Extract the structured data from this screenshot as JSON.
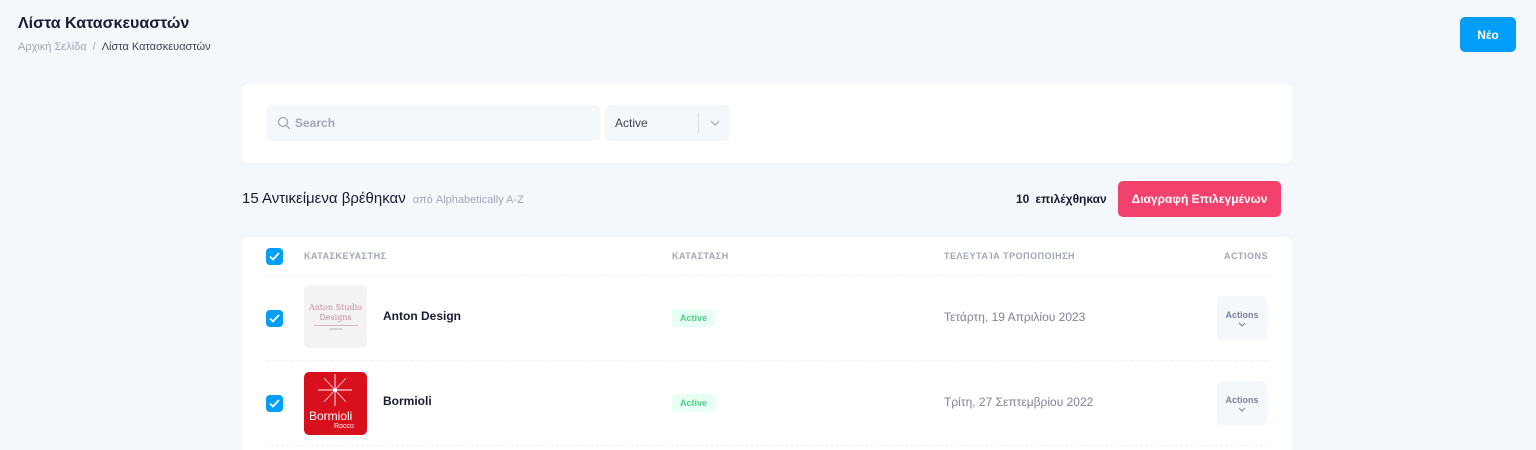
{
  "header": {
    "title": "Λίστα Κατασκευαστών",
    "breadcrumb": {
      "home": "Αρχική Σελίδα",
      "separator": "/",
      "current": "Λίστα Κατασκευαστών"
    },
    "new_button": "Νέο"
  },
  "filters": {
    "search_placeholder": "Search",
    "status_value": "Active"
  },
  "toolbar": {
    "count_text": "15 Αντικείμενα βρέθηκαν",
    "sort_text": "από Alphabetically A-Z",
    "selected_number": "10",
    "selected_label": "επιλέχθηκαν",
    "delete_button": "Διαγραφή Επιλεγμένων"
  },
  "table": {
    "columns": [
      "ΚΑΤΑΣΚΕΥΑΣΤΗΣ",
      "ΚΑΤΑΣΤΑΣΗ",
      "ΤΕΛΕΥΤΑΊΑ ΤΡΟΠΟΠΟΙΗΣΗ",
      "ACTIONS"
    ],
    "rows": [
      {
        "name": "Anton Design",
        "status": "Active",
        "date": "Τετάρτη, 19 Απριλίου 2023",
        "action": "Actions",
        "checked": true,
        "logo": {
          "line1": "Anton Studio",
          "line2": "Designs",
          "line3": "LONDON"
        }
      },
      {
        "name": "Bormioli",
        "status": "Active",
        "date": "Τρίτη, 27 Σεπτεμβρίου 2022",
        "action": "Actions",
        "checked": true,
        "logo": {
          "line1": "Bormioli",
          "line2": "Rocco"
        }
      }
    ]
  },
  "colors": {
    "primary": "#009ef7",
    "danger": "#f1416c",
    "success": "#50cd89",
    "bormioli_red": "#d8101e"
  }
}
